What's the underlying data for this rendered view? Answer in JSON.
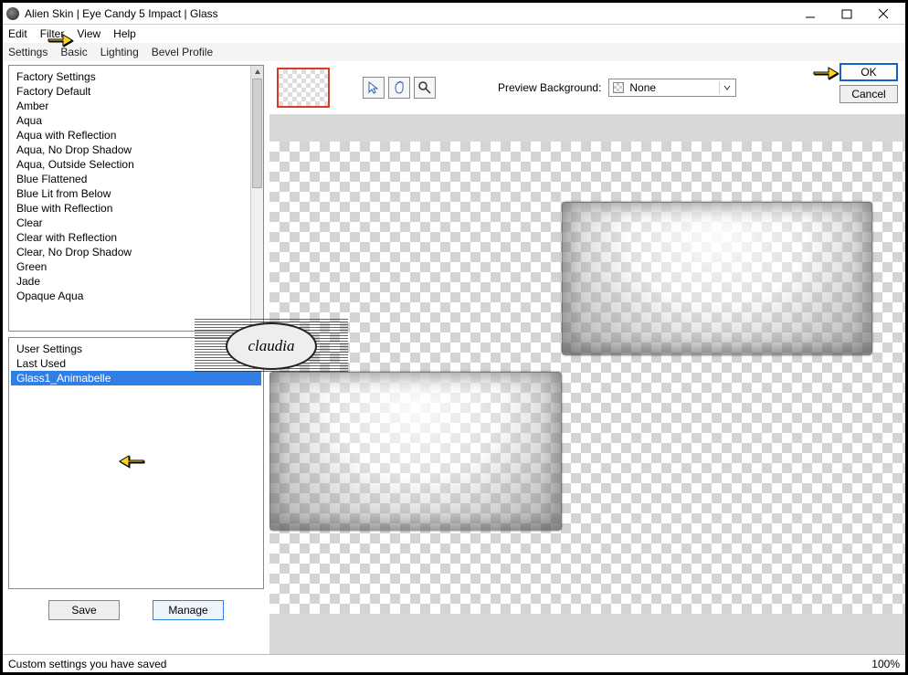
{
  "window": {
    "title": "Alien Skin | Eye Candy 5 Impact | Glass"
  },
  "menu": {
    "edit": "Edit",
    "filter": "Filter",
    "view": "View",
    "help": "Help"
  },
  "tabs": {
    "settings": "Settings",
    "basic": "Basic",
    "lighting": "Lighting",
    "bevel": "Bevel Profile"
  },
  "factory": {
    "header": "Factory Settings",
    "items": [
      "Factory Default",
      "Amber",
      "Aqua",
      "Aqua with Reflection",
      "Aqua, No Drop Shadow",
      "Aqua, Outside Selection",
      "Blue Flattened",
      "Blue Lit from Below",
      "Blue with Reflection",
      "Clear",
      "Clear with Reflection",
      "Clear, No Drop Shadow",
      "Green",
      "Jade",
      "Opaque Aqua"
    ]
  },
  "user": {
    "header": "User Settings",
    "last_used": "Last Used",
    "selected": "Glass1_Animabelle"
  },
  "buttons": {
    "save": "Save",
    "manage": "Manage",
    "ok": "OK",
    "cancel": "Cancel"
  },
  "preview_bg": {
    "label": "Preview Background:",
    "value": "None"
  },
  "status": {
    "text": "Custom settings you have saved",
    "zoom": "100%"
  },
  "watermark": {
    "text": "claudia"
  }
}
